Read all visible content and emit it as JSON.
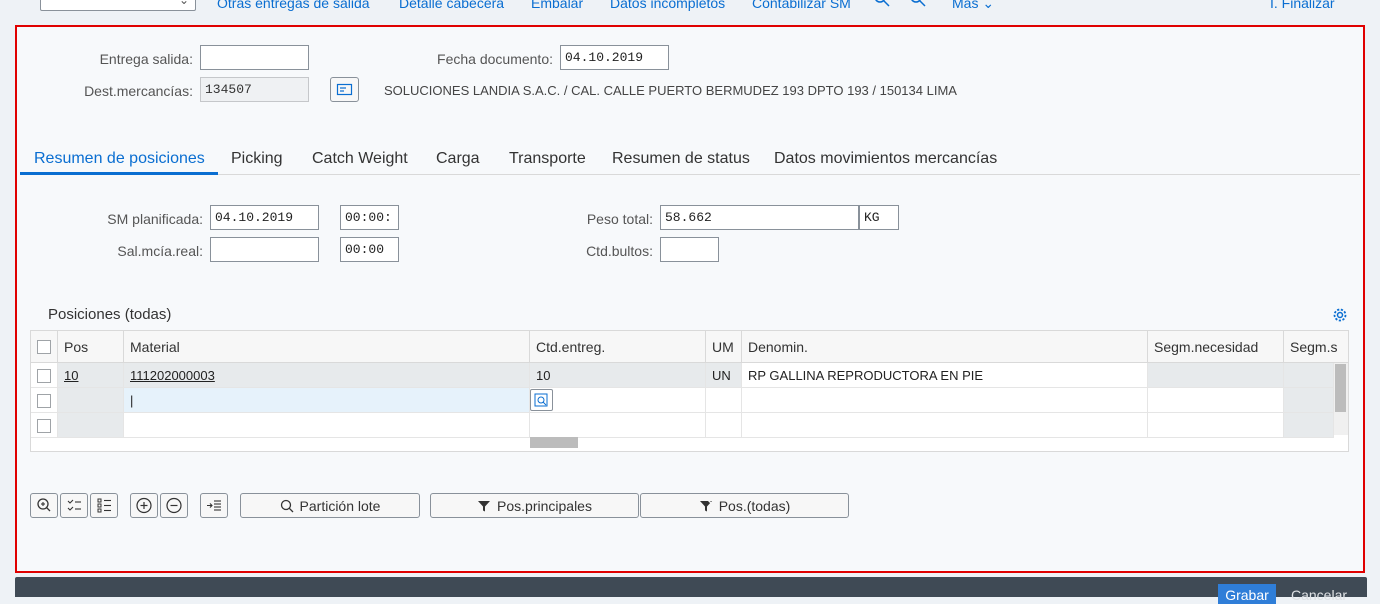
{
  "toolbar": {
    "items": [
      "Otras entregas de salida",
      "Detalle cabecera",
      "Embalar",
      "Datos incompletos",
      "Contabilizar SM"
    ],
    "more_label": "Más",
    "finish_label": "I. Finalizar"
  },
  "header": {
    "entrega_label": "Entrega salida:",
    "entrega_value": "",
    "fecha_label": "Fecha documento:",
    "fecha_value": "04.10.2019",
    "dest_label": "Dest.mercancías:",
    "dest_value": "134507",
    "dest_desc": "SOLUCIONES LANDIA S.A.C. / CAL. CALLE PUERTO BERMUDEZ 193 DPTO 193 / 150134 LIMA"
  },
  "tabs": [
    "Resumen de posiciones",
    "Picking",
    "Catch Weight",
    "Carga",
    "Transporte",
    "Resumen de status",
    "Datos movimientos mercancías"
  ],
  "overview": {
    "sm_label": "SM planificada:",
    "sm_date": "04.10.2019",
    "sm_time": "00:00:",
    "sal_label": "Sal.mcía.real:",
    "sal_date": "",
    "sal_time": "00:00",
    "peso_label": "Peso total:",
    "peso_value": "58.662",
    "peso_unit": "KG",
    "bultos_label": "Ctd.bultos:",
    "bultos_value": ""
  },
  "table": {
    "title": "Posiciones (todas)",
    "columns": [
      "Pos",
      "Material",
      "Ctd.entreg.",
      "UM",
      "Denomin.",
      "Segm.necesidad",
      "Segm.s"
    ],
    "rows": [
      {
        "pos": "10",
        "material": "111202000003",
        "ctd": "10",
        "um": "UN",
        "denom": "RP GALLINA REPRODUCTORA EN PIE"
      }
    ],
    "cursor_text": "|"
  },
  "buttons": {
    "particion": "Partición lote",
    "principales": "Pos.principales",
    "todas": "Pos.(todas)"
  },
  "footer": {
    "save": "Grabar",
    "cancel": "Cancelar"
  },
  "colors": {
    "accent": "#0a6ed1",
    "frame": "#e00000",
    "footer_bg": "#3f4a55"
  }
}
